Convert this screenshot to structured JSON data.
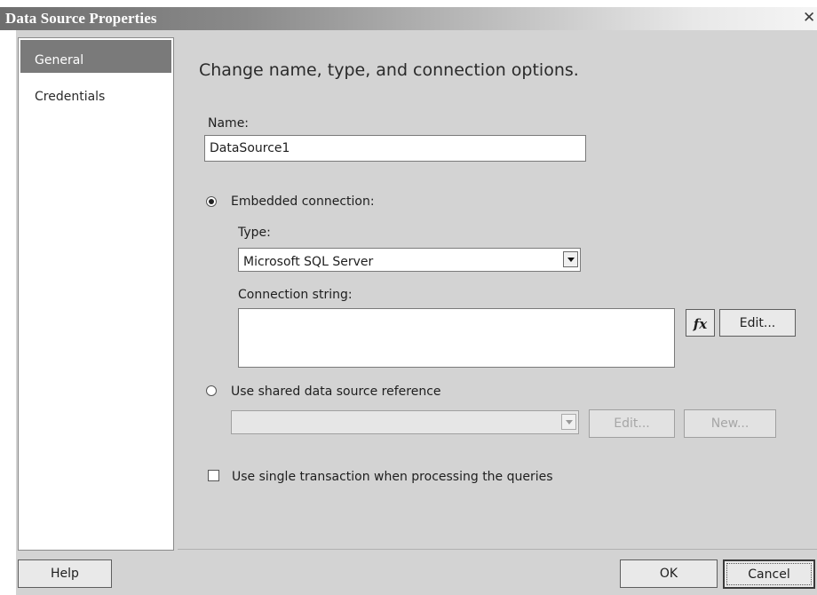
{
  "window": {
    "title": "Data Source Properties",
    "close_glyph": "✕"
  },
  "sidebar": {
    "items": [
      {
        "label": "General",
        "selected": true
      },
      {
        "label": "Credentials",
        "selected": false
      }
    ]
  },
  "main": {
    "heading": "Change name, type, and connection options.",
    "name_label": "Name:",
    "name_value": "DataSource1",
    "embedded_label": "Embedded connection:",
    "embedded_selected": true,
    "type_label": "Type:",
    "type_value": "Microsoft SQL Server",
    "connection_label": "Connection string:",
    "connection_value": "",
    "fx_label": "fx",
    "edit_label": "Edit...",
    "shared_label": "Use shared data source reference",
    "shared_selected": false,
    "shared_value": "",
    "shared_edit_label": "Edit...",
    "shared_new_label": "New...",
    "single_txn_label": "Use single transaction when processing the queries",
    "single_txn_checked": false
  },
  "footer": {
    "help_label": "Help",
    "ok_label": "OK",
    "cancel_label": "Cancel"
  }
}
